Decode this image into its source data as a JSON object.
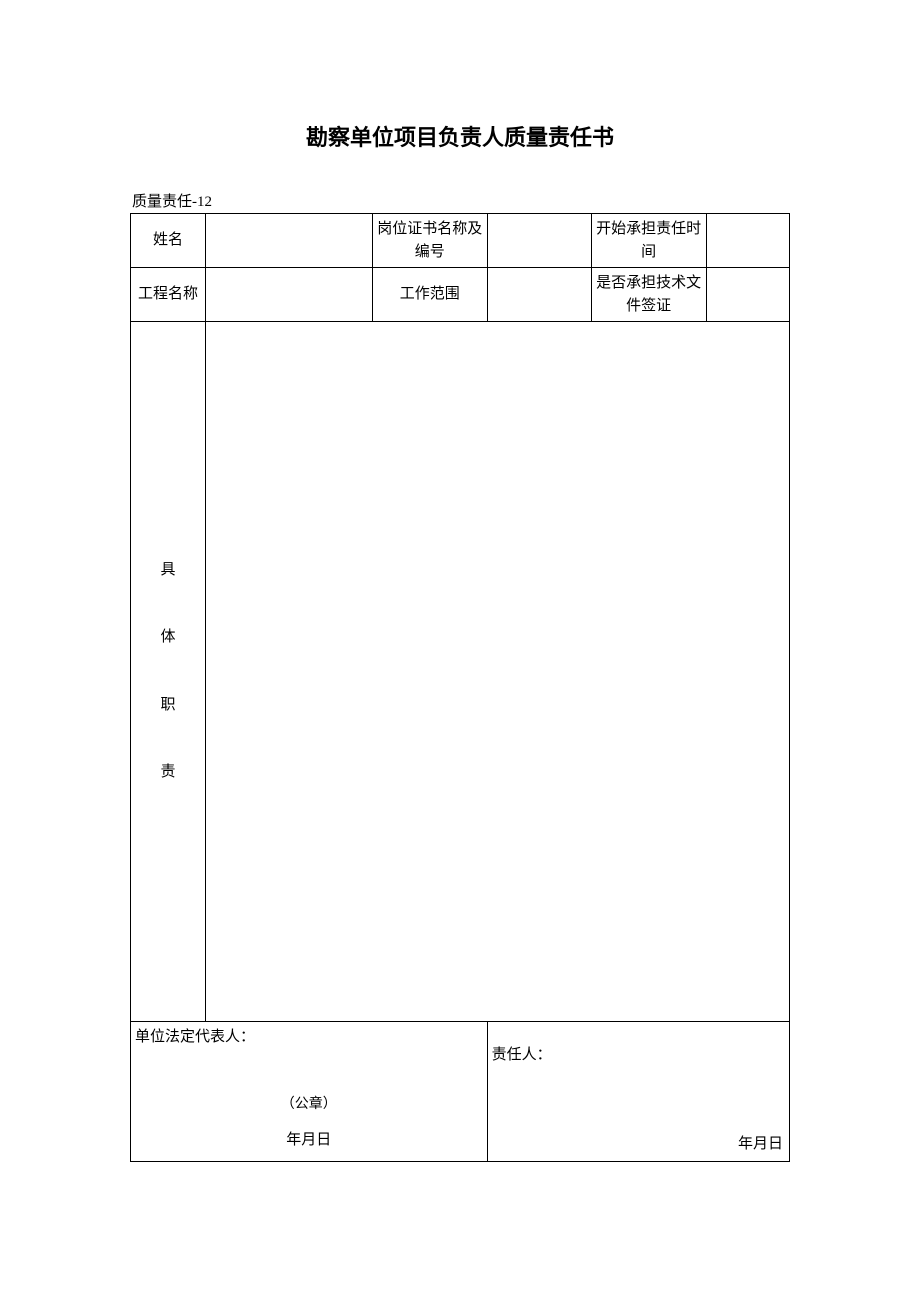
{
  "title": "勘察单位项目负责人质量责任书",
  "subtitle": "质量责任-12",
  "row1": {
    "label1": "姓名",
    "value1": "",
    "label2": "岗位证书名称及编号",
    "value2": "",
    "label3": "开始承担责任时间",
    "value3": ""
  },
  "row2": {
    "label1": "工程名称",
    "value1": "",
    "label2": "工作范围",
    "value2": "",
    "label3": "是否承担技术文件签证",
    "value3": ""
  },
  "duties": {
    "label_chars": [
      "具",
      "体",
      "职",
      "责"
    ],
    "content": ""
  },
  "signature": {
    "left_label": "单位法定代表人：",
    "stamp": "（公章）",
    "left_date": "年月日",
    "right_label": "责任人：",
    "right_date": "年月日"
  }
}
